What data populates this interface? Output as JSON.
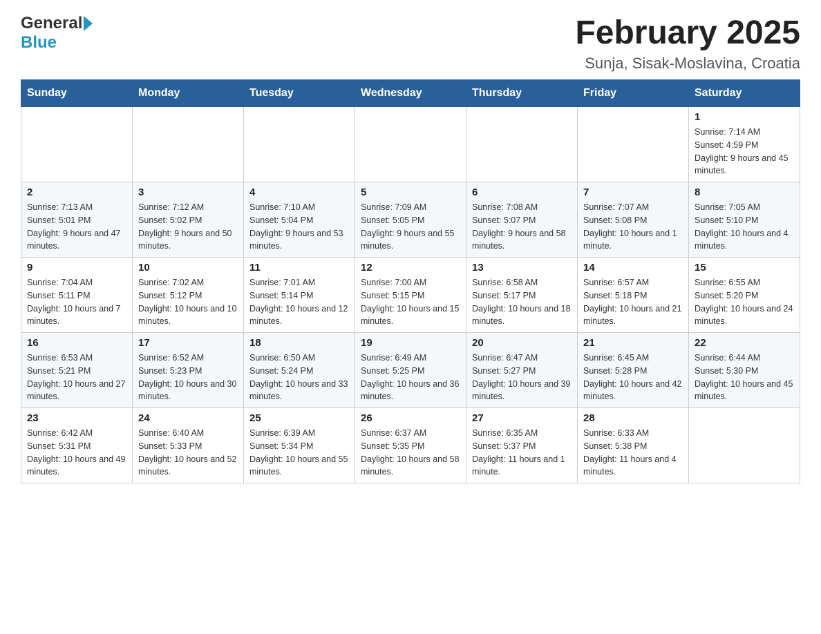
{
  "header": {
    "logo_general": "General",
    "logo_blue": "Blue",
    "month_title": "February 2025",
    "location": "Sunja, Sisak-Moslavina, Croatia"
  },
  "days_of_week": [
    "Sunday",
    "Monday",
    "Tuesday",
    "Wednesday",
    "Thursday",
    "Friday",
    "Saturday"
  ],
  "weeks": [
    {
      "days": [
        {
          "date": "",
          "info": ""
        },
        {
          "date": "",
          "info": ""
        },
        {
          "date": "",
          "info": ""
        },
        {
          "date": "",
          "info": ""
        },
        {
          "date": "",
          "info": ""
        },
        {
          "date": "",
          "info": ""
        },
        {
          "date": "1",
          "info": "Sunrise: 7:14 AM\nSunset: 4:59 PM\nDaylight: 9 hours and 45 minutes."
        }
      ]
    },
    {
      "days": [
        {
          "date": "2",
          "info": "Sunrise: 7:13 AM\nSunset: 5:01 PM\nDaylight: 9 hours and 47 minutes."
        },
        {
          "date": "3",
          "info": "Sunrise: 7:12 AM\nSunset: 5:02 PM\nDaylight: 9 hours and 50 minutes."
        },
        {
          "date": "4",
          "info": "Sunrise: 7:10 AM\nSunset: 5:04 PM\nDaylight: 9 hours and 53 minutes."
        },
        {
          "date": "5",
          "info": "Sunrise: 7:09 AM\nSunset: 5:05 PM\nDaylight: 9 hours and 55 minutes."
        },
        {
          "date": "6",
          "info": "Sunrise: 7:08 AM\nSunset: 5:07 PM\nDaylight: 9 hours and 58 minutes."
        },
        {
          "date": "7",
          "info": "Sunrise: 7:07 AM\nSunset: 5:08 PM\nDaylight: 10 hours and 1 minute."
        },
        {
          "date": "8",
          "info": "Sunrise: 7:05 AM\nSunset: 5:10 PM\nDaylight: 10 hours and 4 minutes."
        }
      ]
    },
    {
      "days": [
        {
          "date": "9",
          "info": "Sunrise: 7:04 AM\nSunset: 5:11 PM\nDaylight: 10 hours and 7 minutes."
        },
        {
          "date": "10",
          "info": "Sunrise: 7:02 AM\nSunset: 5:12 PM\nDaylight: 10 hours and 10 minutes."
        },
        {
          "date": "11",
          "info": "Sunrise: 7:01 AM\nSunset: 5:14 PM\nDaylight: 10 hours and 12 minutes."
        },
        {
          "date": "12",
          "info": "Sunrise: 7:00 AM\nSunset: 5:15 PM\nDaylight: 10 hours and 15 minutes."
        },
        {
          "date": "13",
          "info": "Sunrise: 6:58 AM\nSunset: 5:17 PM\nDaylight: 10 hours and 18 minutes."
        },
        {
          "date": "14",
          "info": "Sunrise: 6:57 AM\nSunset: 5:18 PM\nDaylight: 10 hours and 21 minutes."
        },
        {
          "date": "15",
          "info": "Sunrise: 6:55 AM\nSunset: 5:20 PM\nDaylight: 10 hours and 24 minutes."
        }
      ]
    },
    {
      "days": [
        {
          "date": "16",
          "info": "Sunrise: 6:53 AM\nSunset: 5:21 PM\nDaylight: 10 hours and 27 minutes."
        },
        {
          "date": "17",
          "info": "Sunrise: 6:52 AM\nSunset: 5:23 PM\nDaylight: 10 hours and 30 minutes."
        },
        {
          "date": "18",
          "info": "Sunrise: 6:50 AM\nSunset: 5:24 PM\nDaylight: 10 hours and 33 minutes."
        },
        {
          "date": "19",
          "info": "Sunrise: 6:49 AM\nSunset: 5:25 PM\nDaylight: 10 hours and 36 minutes."
        },
        {
          "date": "20",
          "info": "Sunrise: 6:47 AM\nSunset: 5:27 PM\nDaylight: 10 hours and 39 minutes."
        },
        {
          "date": "21",
          "info": "Sunrise: 6:45 AM\nSunset: 5:28 PM\nDaylight: 10 hours and 42 minutes."
        },
        {
          "date": "22",
          "info": "Sunrise: 6:44 AM\nSunset: 5:30 PM\nDaylight: 10 hours and 45 minutes."
        }
      ]
    },
    {
      "days": [
        {
          "date": "23",
          "info": "Sunrise: 6:42 AM\nSunset: 5:31 PM\nDaylight: 10 hours and 49 minutes."
        },
        {
          "date": "24",
          "info": "Sunrise: 6:40 AM\nSunset: 5:33 PM\nDaylight: 10 hours and 52 minutes."
        },
        {
          "date": "25",
          "info": "Sunrise: 6:39 AM\nSunset: 5:34 PM\nDaylight: 10 hours and 55 minutes."
        },
        {
          "date": "26",
          "info": "Sunrise: 6:37 AM\nSunset: 5:35 PM\nDaylight: 10 hours and 58 minutes."
        },
        {
          "date": "27",
          "info": "Sunrise: 6:35 AM\nSunset: 5:37 PM\nDaylight: 11 hours and 1 minute."
        },
        {
          "date": "28",
          "info": "Sunrise: 6:33 AM\nSunset: 5:38 PM\nDaylight: 11 hours and 4 minutes."
        },
        {
          "date": "",
          "info": ""
        }
      ]
    }
  ]
}
